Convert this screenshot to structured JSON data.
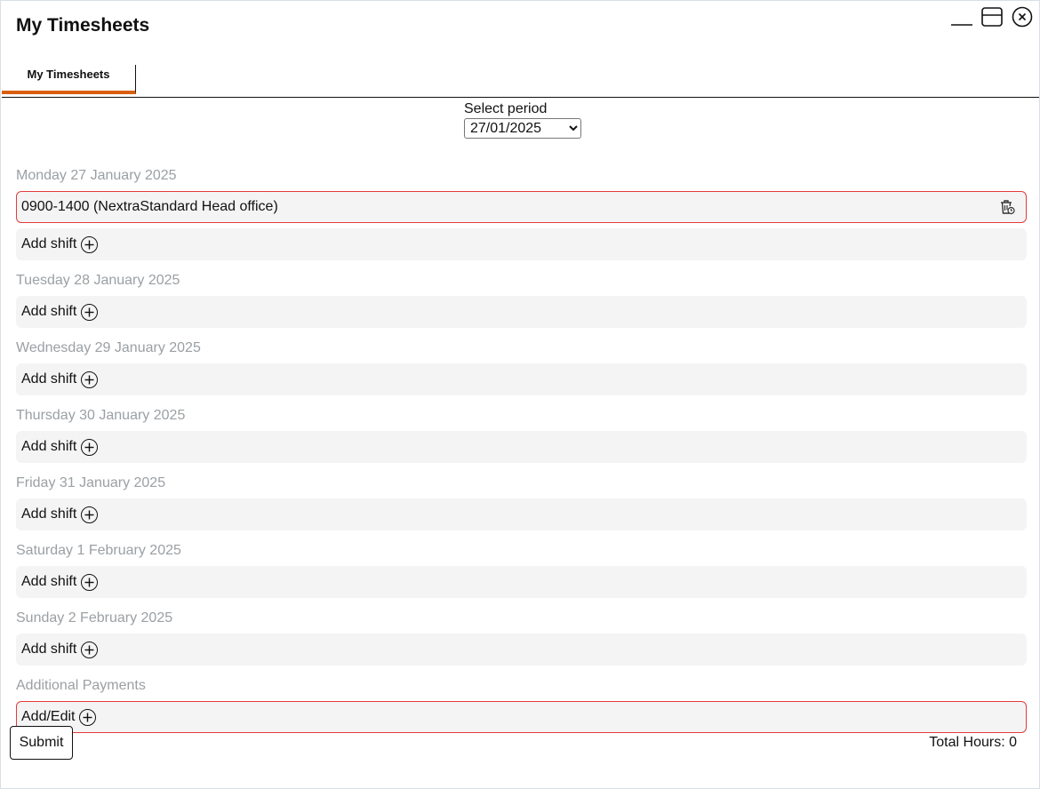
{
  "window": {
    "title": "My Timesheets"
  },
  "tabs": [
    {
      "label": "My Timesheets",
      "active": true
    }
  ],
  "period": {
    "label": "Select period",
    "selected": "27/01/2025"
  },
  "days": [
    {
      "heading": "Monday 27 January 2025",
      "shifts": [
        "0900-1400 (NextraStandard Head office)"
      ],
      "add_label": "Add shift"
    },
    {
      "heading": "Tuesday 28 January 2025",
      "shifts": [],
      "add_label": "Add shift"
    },
    {
      "heading": "Wednesday 29 January 2025",
      "shifts": [],
      "add_label": "Add shift"
    },
    {
      "heading": "Thursday 30 January 2025",
      "shifts": [],
      "add_label": "Add shift"
    },
    {
      "heading": "Friday 31 January 2025",
      "shifts": [],
      "add_label": "Add shift"
    },
    {
      "heading": "Saturday 1 February 2025",
      "shifts": [],
      "add_label": "Add shift"
    },
    {
      "heading": "Sunday 2 February 2025",
      "shifts": [],
      "add_label": "Add shift"
    }
  ],
  "additional": {
    "heading": "Additional Payments",
    "add_label": "Add/Edit"
  },
  "footer": {
    "submit_label": "Submit",
    "total_hours": "Total Hours: 0"
  },
  "colors": {
    "accent_tab": "#d95f0e",
    "error_border": "#e33b3b",
    "row_bg": "#f4f4f4",
    "heading_grey": "#9ba0a4"
  },
  "icons": {
    "minimize": "minimize-icon",
    "maximize": "maximize-icon",
    "close": "close-icon",
    "delete": "trash-icon",
    "add": "plus-circle-icon"
  }
}
